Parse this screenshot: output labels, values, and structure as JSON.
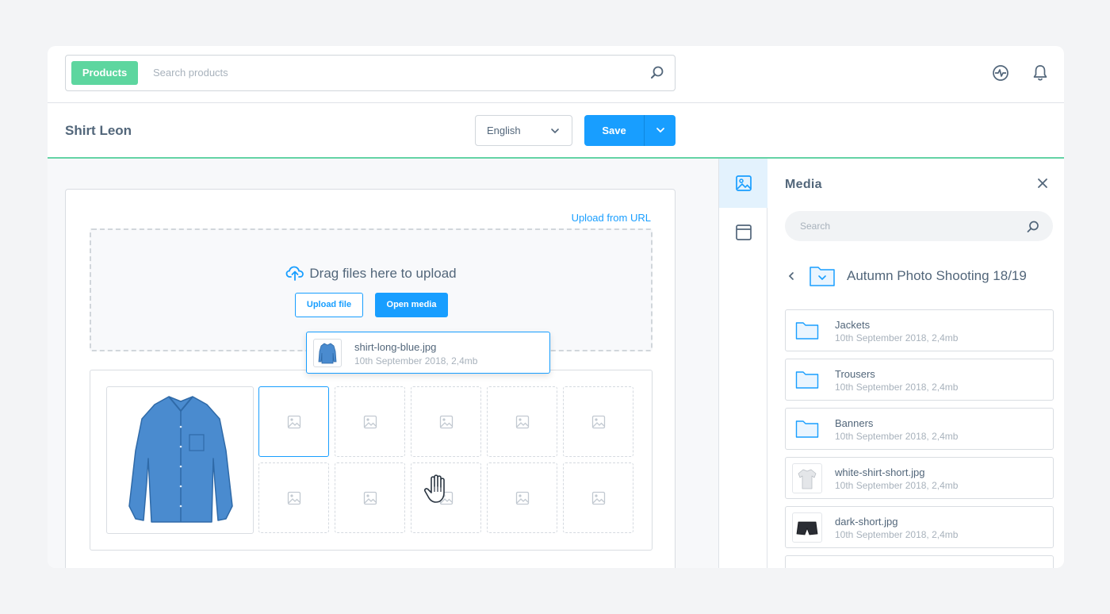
{
  "header": {
    "badge": "Products",
    "search_placeholder": "Search products",
    "icons": [
      "search-icon",
      "activity-icon",
      "bell-icon"
    ]
  },
  "titlebar": {
    "title": "Shirt Leon",
    "language": "English",
    "save_label": "Save"
  },
  "upload": {
    "url_link": "Upload from URL",
    "drop_text": "Drag files here to upload",
    "upload_file_label": "Upload file",
    "open_media_label": "Open media"
  },
  "drag_item": {
    "name": "shirt-long-blue.jpg",
    "meta": "10th September 2018, 2,4mb"
  },
  "media": {
    "title": "Media",
    "search_placeholder": "Search",
    "folder": "Autumn Photo Shooting 18/19",
    "items": [
      {
        "name": "Jackets",
        "meta": "10th September 2018, 2,4mb",
        "kind": "folder"
      },
      {
        "name": "Trousers",
        "meta": "10th September 2018, 2,4mb",
        "kind": "folder"
      },
      {
        "name": "Banners",
        "meta": "10th September 2018, 2,4mb",
        "kind": "folder"
      },
      {
        "name": "white-shirt-short.jpg",
        "meta": "10th September 2018, 2,4mb",
        "kind": "image"
      },
      {
        "name": "dark-short.jpg",
        "meta": "10th September 2018, 2,4mb",
        "kind": "image"
      }
    ]
  },
  "colors": {
    "accent": "#189eff",
    "badge": "#5dd69f",
    "divider": "#64d3a5",
    "text": "#52667a",
    "muted": "#a8b2bc"
  }
}
